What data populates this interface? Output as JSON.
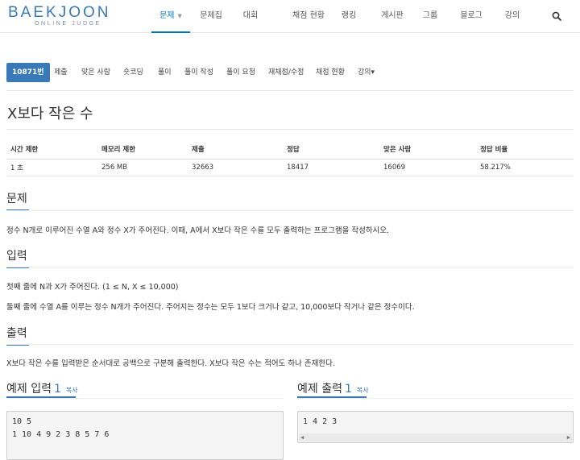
{
  "logo": {
    "main": "BAEKJOON",
    "sub": "ONLINE JUDGE"
  },
  "nav": {
    "items": [
      "문제",
      "문제집",
      "대회",
      "채점 현황",
      "랭킹",
      "게시판",
      "그룹",
      "블로그",
      "강의"
    ],
    "active_caret": "▼"
  },
  "subtabs": [
    "10871번",
    "제출",
    "맞은 사람",
    "숏코딩",
    "풀이",
    "풀이 작성",
    "풀이 요청",
    "재채점/수정",
    "채점 현황",
    "강의▾"
  ],
  "title": "X보다 작은 수",
  "info": {
    "headers": [
      "시간 제한",
      "메모리 제한",
      "제출",
      "정답",
      "맞은 사람",
      "정답 비율"
    ],
    "values": [
      "1 초",
      "256 MB",
      "32663",
      "18417",
      "16069",
      "58.217%"
    ]
  },
  "problem": {
    "heading": "문제",
    "text": "정수 N개로 이루어진 수열 A와 정수 X가 주어진다. 이때, A에서 X보다 작은 수를 모두 출력하는 프로그램을 작성하시오."
  },
  "input": {
    "heading": "입력",
    "line1": "첫째 줄에 N과 X가 주어진다. (1 ≤ N, X ≤ 10,000)",
    "line2": "둘째 줄에 수열 A를 이루는 정수 N개가 주어진다. 주어지는 정수는 모두 1보다 크거나 같고, 10,000보다 작거나 같은 정수이다."
  },
  "output": {
    "heading": "출력",
    "text": "X보다 작은 수를 입력받은 순서대로 공백으로 구분해 출력한다. X보다 작은 수는 적어도 하나 존재한다."
  },
  "example_input": {
    "label": "예제 입력",
    "number": "1",
    "copy": "복사",
    "lines": [
      "10 5",
      "1 10 4 9 2 3 8 5 7 6"
    ]
  },
  "example_output": {
    "label": "예제 출력",
    "number": "1",
    "copy": "복사",
    "lines": [
      "1 4 2 3"
    ]
  },
  "colors": {
    "accent": "#3a79b7",
    "nav_active": "#0076c0"
  }
}
